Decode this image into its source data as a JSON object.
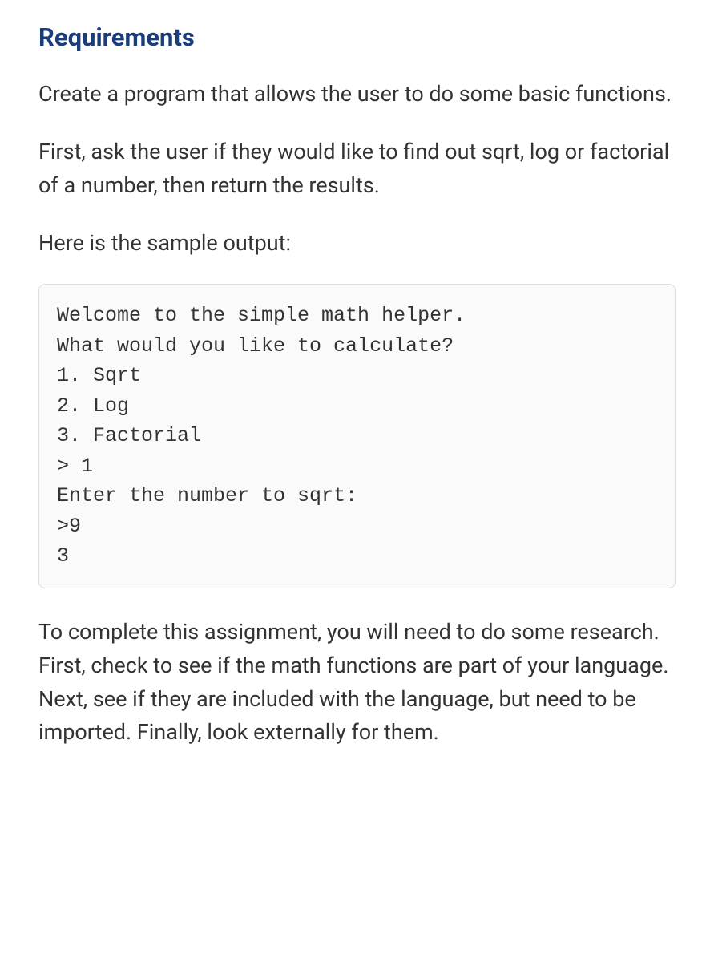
{
  "heading": "Requirements",
  "para1": "Create a program that allows the user to do some basic functions.",
  "para2": "First, ask the user if they would like to find out sqrt, log or factorial of a number, then return the results.",
  "para3": "Here is the sample output:",
  "code": "Welcome to the simple math helper.\nWhat would you like to calculate?\n1. Sqrt\n2. Log\n3. Factorial\n> 1\nEnter the number to sqrt:\n>9\n3",
  "para4": "To complete this assignment, you will need to do some research. First, check to see if the math functions are part of your language. Next, see if they are included with the language, but need to be imported. Finally, look externally for them."
}
